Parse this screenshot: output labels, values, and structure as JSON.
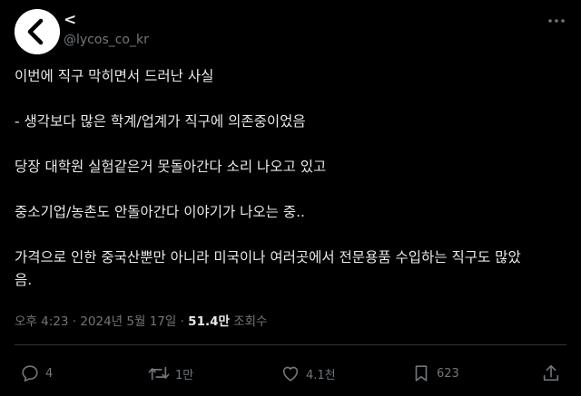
{
  "account": {
    "display_name": "<",
    "handle": "@lycos_co_kr"
  },
  "tweet": {
    "paragraphs": [
      "이번에 직구 막히면서 드러난 사실",
      "- 생각보다 많은 학계/업계가 직구에 의존중이었음",
      "당장 대학원 실험같은거 못돌아간다 소리 나오고 있고",
      "중소기업/농촌도 안돌아간다 이야기가 나오는 중..",
      "가격으로 인한 중국산뿐만 아니라 미국이나 여러곳에서 전문용품 수입하는 직구도 많았\n음."
    ]
  },
  "meta": {
    "time": "오후 4:23",
    "separator": " · ",
    "date": "2024년 5월 17일",
    "views_count": "51.4만",
    "views_label": " 조회수"
  },
  "actions": {
    "replies": "4",
    "reposts": "1만",
    "likes": "4.1천",
    "bookmarks": "623"
  },
  "icons": {
    "avatar": "chevron-left-logo",
    "more": "more-horizontal-icon",
    "reply": "reply-icon",
    "repost": "repost-icon",
    "like": "heart-icon",
    "bookmark": "bookmark-icon",
    "share": "share-icon"
  },
  "colors": {
    "background": "#000000",
    "text": "#e7e9ea",
    "muted": "#71767b",
    "divider": "#2f3336"
  }
}
